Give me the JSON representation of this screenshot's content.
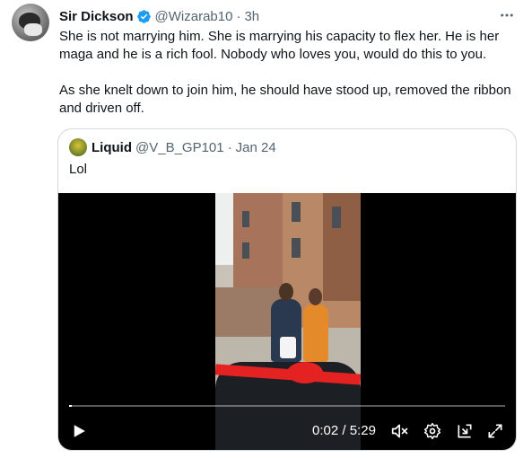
{
  "tweet": {
    "author_name": "Sir Dickson",
    "author_handle": "@Wizarab10",
    "separator": "·",
    "time": "3h",
    "verified_icon": "verified-badge-icon",
    "more_icon": "more-horizontal-icon",
    "text_p1": "She is not marrying him. She is marrying his capacity to flex her. He is her maga and he is a rich fool. Nobody who loves you, would do this to you.",
    "text_p2": "As she knelt down to join him, he should have stood up, removed the ribbon and driven off."
  },
  "quote": {
    "author_name": "Liquid",
    "author_handle": "@V_B_GP101",
    "separator": "·",
    "date": "Jan 24",
    "text": "Lol"
  },
  "video": {
    "current_time": "0:02",
    "time_separator": "/",
    "duration": "5:29",
    "progress": 0.0063,
    "controls": {
      "play_icon": "play-icon",
      "mute_icon": "volume-muted-icon",
      "settings_icon": "settings-gear-icon",
      "pip_icon": "picture-in-picture-icon",
      "fullscreen_icon": "fullscreen-icon"
    }
  },
  "colors": {
    "verified_blue": "#1d9bf0",
    "secondary_text": "#536471",
    "border": "#cfd9de"
  }
}
